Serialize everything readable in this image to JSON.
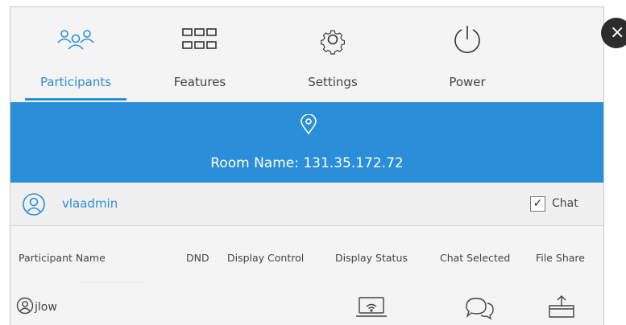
{
  "tabs": [
    {
      "label": "Participants",
      "icon": "participants-icon",
      "active": true
    },
    {
      "label": "Features",
      "icon": "features-grid-icon",
      "active": false
    },
    {
      "label": "Settings",
      "icon": "settings-gear-icon",
      "active": false
    },
    {
      "label": "Power",
      "icon": "power-icon",
      "active": false
    }
  ],
  "room": {
    "label": "Room Name: 131.35.172.72",
    "icon": "location-pin-icon"
  },
  "user": {
    "name": "vlaadmin",
    "icon": "user-avatar-icon",
    "chat_label": "Chat",
    "chat_checked": true,
    "check_mark": "✓"
  },
  "table": {
    "headers": [
      "Participant Name",
      "DND",
      "Display Control",
      "Display Status",
      "Chat Selected",
      "File Share"
    ],
    "rows": [
      {
        "name": "jlow",
        "icons": [
          "display-status-laptop-icon",
          "chat-bubble-icon",
          "file-share-icon"
        ]
      }
    ]
  },
  "close_label": "×",
  "colors": {
    "accent": "#2a8ed8",
    "background": "#f4f4f4",
    "close_button": "#2c2c2c"
  }
}
